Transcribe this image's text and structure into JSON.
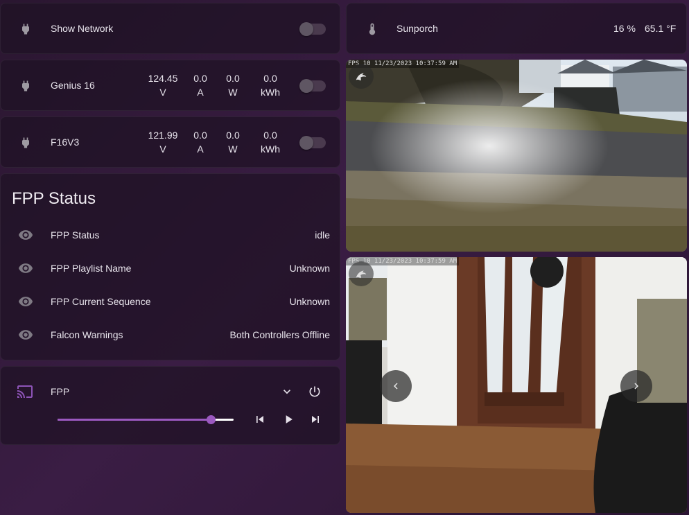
{
  "colors": {
    "accent": "#9b59c0",
    "icon": "#9e9aa2",
    "cast_icon": "#8e54b8"
  },
  "cards": {
    "show_network": {
      "name": "Show Network",
      "icon": "power-plug-icon",
      "switch_on": false
    },
    "sunporch": {
      "name": "Sunporch",
      "icon": "thermometer-icon",
      "humidity": "16 %",
      "temperature": "65.1 °F"
    },
    "genius16": {
      "name": "Genius 16",
      "icon": "power-plug-icon",
      "switch_on": false,
      "voltage": "124.45",
      "voltage_unit": "V",
      "current": "0.0",
      "current_unit": "A",
      "power": "0.0",
      "power_unit": "W",
      "energy": "0.0",
      "energy_unit": "kWh"
    },
    "f16v3": {
      "name": "F16V3",
      "icon": "power-plug-icon",
      "switch_on": false,
      "voltage": "121.99",
      "voltage_unit": "V",
      "current": "0.0",
      "current_unit": "A",
      "power": "0.0",
      "power_unit": "W",
      "energy": "0.0",
      "energy_unit": "kWh"
    }
  },
  "fpp_status": {
    "title": "FPP Status",
    "rows": [
      {
        "label": "FPP Status",
        "value": "idle",
        "icon": "eye-icon"
      },
      {
        "label": "FPP Playlist Name",
        "value": "Unknown",
        "icon": "eye-icon"
      },
      {
        "label": "FPP Current Sequence",
        "value": "Unknown",
        "icon": "eye-icon"
      },
      {
        "label": "Falcon Warnings",
        "value": "Both Controllers Offline",
        "icon": "eye-icon"
      }
    ]
  },
  "media_player": {
    "name": "FPP",
    "icon": "cast-icon",
    "volume_fraction": 0.87
  },
  "cameras": [
    {
      "timestamp": "FPS  10 11/23/2023 10:37:59 AM",
      "scene": "driveway"
    },
    {
      "timestamp": "FPS  10 11/23/2023 10:37:59 AM",
      "scene": "sunporch-door"
    }
  ]
}
